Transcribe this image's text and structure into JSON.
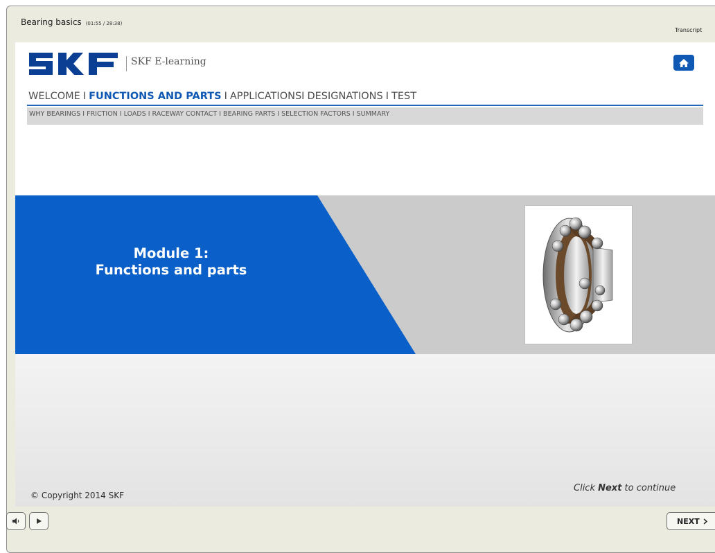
{
  "player": {
    "course_title": "Bearing basics",
    "course_time": "(01:55 / 28:38)",
    "transcript_label": "Transcript"
  },
  "header": {
    "logo_text": "SKF",
    "product_name": "SKF E-learning",
    "home_icon": "home-icon"
  },
  "main_nav": {
    "items": [
      {
        "label": "WELCOME",
        "active": false
      },
      {
        "label": "FUNCTIONS AND PARTS",
        "active": true
      },
      {
        "label": "APPLICATIONS",
        "active": false
      },
      {
        "label": "DESIGNATIONS",
        "active": false
      },
      {
        "label": "TEST",
        "active": false
      }
    ],
    "separator": "I"
  },
  "sub_nav": {
    "items": [
      "WHY BEARINGS",
      "FRICTION",
      "LOADS",
      "RACEWAY CONTACT",
      "BEARING PARTS",
      "SELECTION FACTORS",
      "SUMMARY"
    ],
    "separator": "I"
  },
  "banner": {
    "module_line1": "Module 1:",
    "module_line2": "Functions and parts",
    "image_subject": "self-aligning-ball-bearing-image"
  },
  "footer": {
    "copyright": "© Copyright 2014 SKF",
    "hint_pre": "Click ",
    "hint_bold": "Next",
    "hint_post": " to continue"
  },
  "controls": {
    "audio_icon": "speaker-icon",
    "play_icon": "play-icon",
    "next_label": "NEXT",
    "next_icon": "chevron-right-icon"
  },
  "colors": {
    "brand_blue": "#0f58b3",
    "banner_blue": "#0a5fc8",
    "banner_gray": "#cbcbcb",
    "player_chrome": "#ecebe0"
  }
}
